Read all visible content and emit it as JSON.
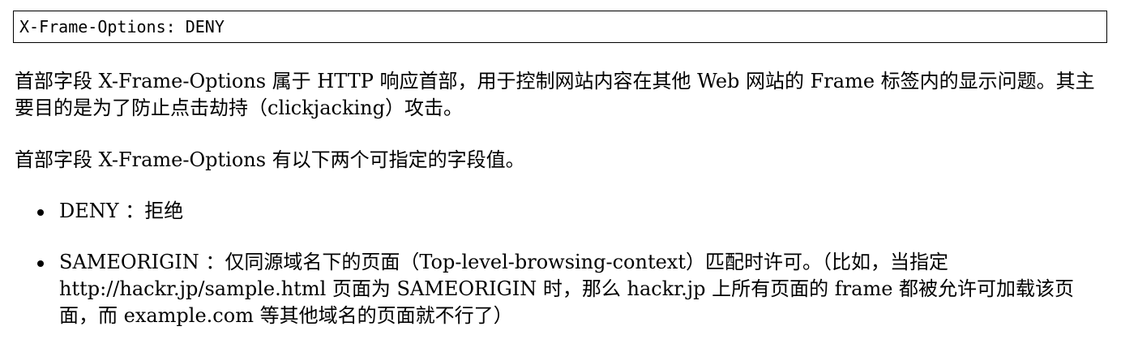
{
  "code_block": {
    "text": "X-Frame-Options: DENY"
  },
  "paragraphs": [
    "首部字段 X-Frame-Options 属于 HTTP 响应首部，用于控制网站内容在其他 Web 网站的 Frame 标签内的显示问题。其主要目的是为了防止点击劫持（clickjacking）攻击。",
    "首部字段 X-Frame-Options 有以下两个可指定的字段值。"
  ],
  "list_items": [
    "DENY ：拒绝",
    "SAMEORIGIN ：仅同源域名下的页面（Top-level-browsing-context）匹配时许可。（比如，当指定 http://hackr.jp/sample.html 页面为 SAMEORIGIN 时，那么 hackr.jp 上所有页面的 frame 都被允许可加载该页面，而 example.com 等其他域名的页面就不行了）"
  ]
}
